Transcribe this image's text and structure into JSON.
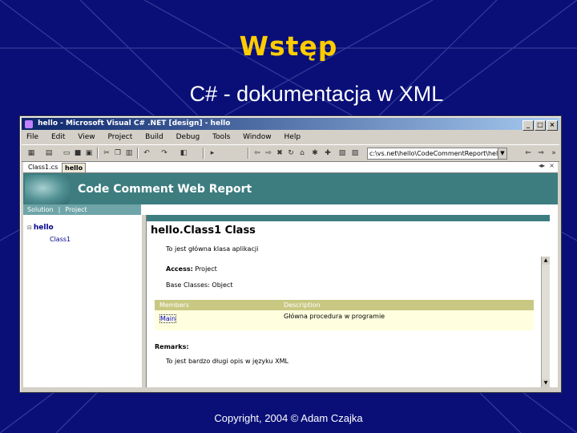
{
  "slide": {
    "title": "Wstęp",
    "subtitle": "C# - dokumentacja w XML",
    "footer": "Copyright, 2004 © Adam Czajka",
    "colors": {
      "background": "#0a0f78",
      "title": "#ffcc00",
      "text": "#ffffff"
    }
  },
  "window": {
    "title": "hello - Microsoft Visual C# .NET [design] - hello",
    "controls": [
      "_",
      "□",
      "×"
    ]
  },
  "menu": [
    "File",
    "Edit",
    "View",
    "Project",
    "Build",
    "Debug",
    "Tools",
    "Window",
    "Help"
  ],
  "toolbar": {
    "path_value": "c:\\vs.net\\hello\\CodeCommentReport\\hello"
  },
  "doc_tabs": [
    "Class1.cs",
    "hello"
  ],
  "report": {
    "header_title": "Code Comment Web Report",
    "nav": {
      "solution": "Solution",
      "separator": "|",
      "project": "Project"
    },
    "tree": {
      "root": "hello",
      "child": "Class1"
    },
    "class_title": "hello.Class1 Class",
    "summary": "To jest główna klasa aplikacji",
    "access_label": "Access:",
    "access_value": "Project",
    "base_label": "Base Classes:",
    "base_value": "Object",
    "members_header": {
      "members": "Members",
      "description": "Description"
    },
    "members": [
      {
        "name": "Main",
        "description": "Główna procedura w programie"
      }
    ],
    "remarks_label": "Remarks:",
    "remarks_text": "To jest bardzo długi opis w języku XML",
    "colors": {
      "header": "#3d7d80",
      "nav": "#6fa5a8",
      "members_head": "#c8c882",
      "members_bg": "#ffffe0"
    }
  }
}
